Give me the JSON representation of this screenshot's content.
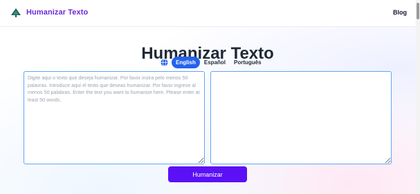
{
  "header": {
    "brand": "Humanizar Texto",
    "nav_blog": "Blog"
  },
  "main": {
    "title": "Humanizar Texto",
    "languages": [
      {
        "label": "English",
        "active": true
      },
      {
        "label": "Español",
        "active": false
      },
      {
        "label": "Português",
        "active": false
      }
    ],
    "input": {
      "value": "",
      "placeholder": "Digite aqui o texto que deseja humanizar. Por favor insira pelo menos 50 palavras. Introduce aquí el texto que deseas humanizar. Por favor ingrese al menos 50 palabras. Enter the text you want to humanize here. Please enter at least 50 words."
    },
    "output": {
      "value": ""
    },
    "submit_label": "Humanizar"
  },
  "icons": {
    "logo": "tree-logo-icon",
    "language": "globe-icon"
  },
  "colors": {
    "brand": "#6d28d9",
    "active_language": "#2563eb",
    "button": "#5b10f5",
    "textarea_border": "#60a5fa",
    "logo_fill": "#1f5e57"
  }
}
